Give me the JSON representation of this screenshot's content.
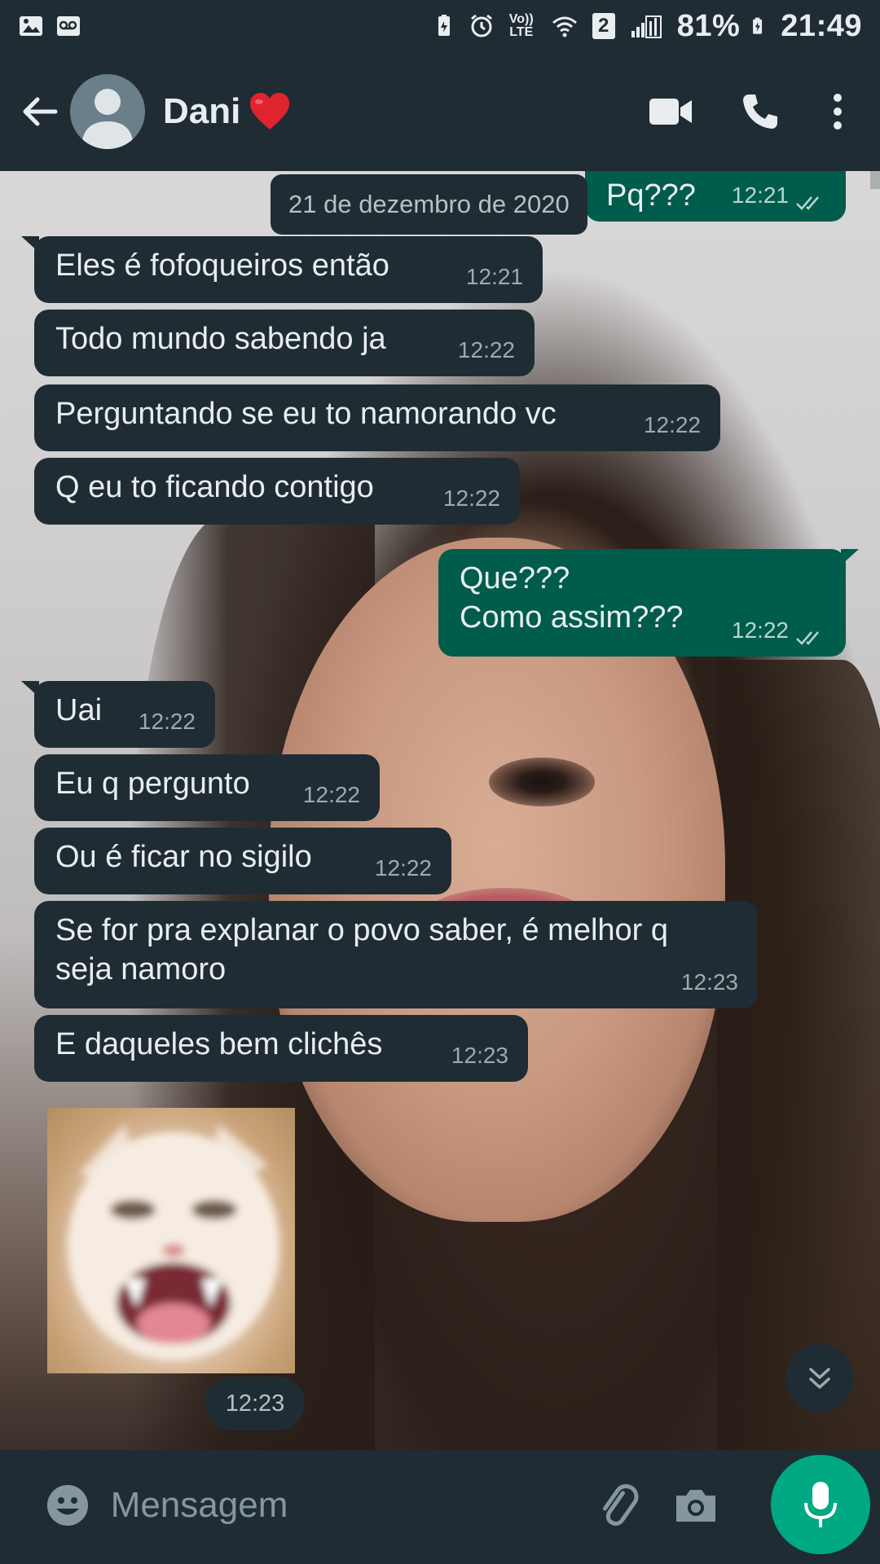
{
  "status_bar": {
    "battery": "81%",
    "time": "21:49",
    "sim_label": "2",
    "network_label": "Vo)) LTE"
  },
  "header": {
    "contact_name": "Dani",
    "heart": "❤"
  },
  "chat": {
    "date_chip": "21 de dezembro de 2020",
    "partial_top": {
      "text": "Pq???",
      "time": "12:21"
    },
    "messages": [
      {
        "dir": "in",
        "text": "Eles é fofoqueiros então",
        "time": "12:21"
      },
      {
        "dir": "in",
        "text": "Todo mundo sabendo ja",
        "time": "12:22"
      },
      {
        "dir": "in",
        "text": "Perguntando se eu to namorando vc",
        "time": "12:22"
      },
      {
        "dir": "in",
        "text": "Q eu to ficando contigo",
        "time": "12:22"
      },
      {
        "dir": "out",
        "text": "Que???\nComo assim???",
        "time": "12:22"
      },
      {
        "dir": "in",
        "text": "Uai",
        "time": "12:22"
      },
      {
        "dir": "in",
        "text": "Eu q pergunto",
        "time": "12:22"
      },
      {
        "dir": "in",
        "text": "Ou é ficar no sigilo",
        "time": "12:22"
      },
      {
        "dir": "in",
        "text": "Se for pra explanar o povo saber, é melhor q\nseja namoro",
        "time": "12:23"
      },
      {
        "dir": "in",
        "text": "E daqueles bem clichês",
        "time": "12:23"
      }
    ],
    "sticker_time": "12:23"
  },
  "input_bar": {
    "placeholder": "Mensagem"
  },
  "icons": {
    "back": "arrow-left-icon",
    "video": "video-call-icon",
    "phone": "phone-call-icon",
    "more": "more-vert-icon",
    "emoji": "emoji-icon",
    "attach": "paperclip-icon",
    "camera": "camera-icon",
    "mic": "mic-icon",
    "scroll": "double-chevron-down-icon"
  },
  "colors": {
    "header_bg": "#1f2c34",
    "incoming_bubble": "#1f2c34",
    "outgoing_bubble": "#005c4b",
    "accent": "#00a884",
    "read_ticks": "#b9d6cf"
  }
}
